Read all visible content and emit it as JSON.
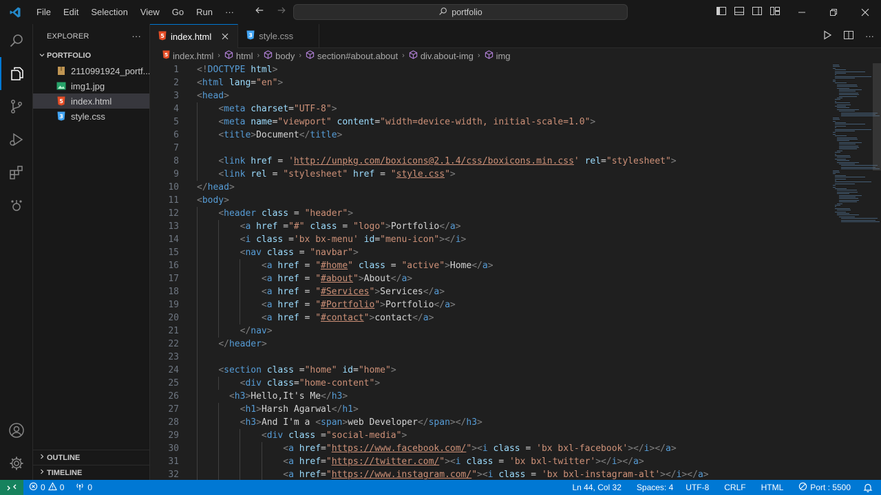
{
  "titlebar": {
    "menus": [
      "File",
      "Edit",
      "Selection",
      "View",
      "Go",
      "Run",
      "···"
    ],
    "search": "portfolio"
  },
  "explorer": {
    "title": "EXPLORER",
    "more": "···",
    "folder": "PORTFOLIO",
    "files": [
      {
        "name": "2110991924_portf...",
        "icon": "zip-icon",
        "color": "#c09553"
      },
      {
        "name": "img1.jpg",
        "icon": "image-icon",
        "color": "#26a269"
      },
      {
        "name": "index.html",
        "icon": "html-icon",
        "color": "#e44d26"
      },
      {
        "name": "style.css",
        "icon": "css-icon",
        "color": "#42a5f5"
      }
    ],
    "outline": "OUTLINE",
    "timeline": "TIMELINE"
  },
  "tabs": [
    {
      "label": "index.html",
      "active": true
    },
    {
      "label": "style.css",
      "active": false
    }
  ],
  "breadcrumb": [
    "index.html",
    "html",
    "body",
    "section#about.about",
    "div.about-img",
    "img"
  ],
  "code_lines": [
    {
      "n": "1",
      "i": 0,
      "t": [
        [
          "br",
          "<!"
        ],
        [
          "tag",
          "DOCTYPE"
        ],
        [
          "txt",
          " "
        ],
        [
          "attr",
          "html"
        ],
        [
          "br",
          ">"
        ]
      ]
    },
    {
      "n": "2",
      "i": 0,
      "t": [
        [
          "br",
          "<"
        ],
        [
          "tag",
          "html"
        ],
        [
          "txt",
          " "
        ],
        [
          "attr",
          "lang"
        ],
        [
          "txt",
          "="
        ],
        [
          "str",
          "\"en\""
        ],
        [
          "br",
          ">"
        ]
      ]
    },
    {
      "n": "3",
      "i": 0,
      "t": [
        [
          "br",
          "<"
        ],
        [
          "tag",
          "head"
        ],
        [
          "br",
          ">"
        ]
      ]
    },
    {
      "n": "4",
      "i": 1,
      "t": [
        [
          "br",
          "<"
        ],
        [
          "tag",
          "meta"
        ],
        [
          "txt",
          " "
        ],
        [
          "attr",
          "charset"
        ],
        [
          "txt",
          "="
        ],
        [
          "str",
          "\"UTF-8\""
        ],
        [
          "br",
          ">"
        ]
      ]
    },
    {
      "n": "5",
      "i": 1,
      "t": [
        [
          "br",
          "<"
        ],
        [
          "tag",
          "meta"
        ],
        [
          "txt",
          " "
        ],
        [
          "attr",
          "name"
        ],
        [
          "txt",
          "="
        ],
        [
          "str",
          "\"viewport\""
        ],
        [
          "txt",
          " "
        ],
        [
          "attr",
          "content"
        ],
        [
          "txt",
          "="
        ],
        [
          "str",
          "\"width=device-width, initial-scale=1.0\""
        ],
        [
          "br",
          ">"
        ]
      ]
    },
    {
      "n": "6",
      "i": 1,
      "t": [
        [
          "br",
          "<"
        ],
        [
          "tag",
          "title"
        ],
        [
          "br",
          ">"
        ],
        [
          "txt",
          "Document"
        ],
        [
          "br",
          "</"
        ],
        [
          "tag",
          "title"
        ],
        [
          "br",
          ">"
        ]
      ]
    },
    {
      "n": "7",
      "i": 1,
      "t": []
    },
    {
      "n": "8",
      "i": 1,
      "t": [
        [
          "br",
          "<"
        ],
        [
          "tag",
          "link"
        ],
        [
          "txt",
          " "
        ],
        [
          "attr",
          "href"
        ],
        [
          "txt",
          " = "
        ],
        [
          "str",
          "'"
        ],
        [
          "link",
          "http://unpkg.com/boxicons@2.1.4/css/boxicons.min.css"
        ],
        [
          "str",
          "'"
        ],
        [
          "txt",
          " "
        ],
        [
          "attr",
          "rel"
        ],
        [
          "txt",
          "="
        ],
        [
          "str",
          "\"stylesheet\""
        ],
        [
          "br",
          ">"
        ]
      ]
    },
    {
      "n": "9",
      "i": 1,
      "t": [
        [
          "br",
          "<"
        ],
        [
          "tag",
          "link"
        ],
        [
          "txt",
          " "
        ],
        [
          "attr",
          "rel"
        ],
        [
          "txt",
          " = "
        ],
        [
          "str",
          "\"stylesheet\""
        ],
        [
          "txt",
          " "
        ],
        [
          "attr",
          "href"
        ],
        [
          "txt",
          " = "
        ],
        [
          "str",
          "\""
        ],
        [
          "link",
          "style.css"
        ],
        [
          "str",
          "\""
        ],
        [
          "br",
          ">"
        ]
      ]
    },
    {
      "n": "10",
      "i": 0,
      "t": [
        [
          "br",
          "</"
        ],
        [
          "tag",
          "head"
        ],
        [
          "br",
          ">"
        ]
      ]
    },
    {
      "n": "11",
      "i": 0,
      "t": [
        [
          "br",
          "<"
        ],
        [
          "tag",
          "body"
        ],
        [
          "br",
          ">"
        ]
      ]
    },
    {
      "n": "12",
      "i": 1,
      "t": [
        [
          "br",
          "<"
        ],
        [
          "tag",
          "header"
        ],
        [
          "txt",
          " "
        ],
        [
          "attr",
          "class"
        ],
        [
          "txt",
          " = "
        ],
        [
          "str",
          "\"header\""
        ],
        [
          "br",
          ">"
        ]
      ]
    },
    {
      "n": "13",
      "i": 2,
      "t": [
        [
          "br",
          "<"
        ],
        [
          "tag",
          "a"
        ],
        [
          "txt",
          " "
        ],
        [
          "attr",
          "href"
        ],
        [
          "txt",
          " ="
        ],
        [
          "str",
          "\"#\""
        ],
        [
          "txt",
          " "
        ],
        [
          "attr",
          "class"
        ],
        [
          "txt",
          " = "
        ],
        [
          "str",
          "\"logo\""
        ],
        [
          "br",
          ">"
        ],
        [
          "txt",
          "Portfolio"
        ],
        [
          "br",
          "</"
        ],
        [
          "tag",
          "a"
        ],
        [
          "br",
          ">"
        ]
      ]
    },
    {
      "n": "14",
      "i": 2,
      "t": [
        [
          "br",
          "<"
        ],
        [
          "tag",
          "i"
        ],
        [
          "txt",
          " "
        ],
        [
          "attr",
          "class"
        ],
        [
          "txt",
          " ="
        ],
        [
          "str",
          "'bx bx-menu'"
        ],
        [
          "txt",
          " "
        ],
        [
          "attr",
          "id"
        ],
        [
          "txt",
          "="
        ],
        [
          "str",
          "\"menu-icon\""
        ],
        [
          "br",
          "></"
        ],
        [
          "tag",
          "i"
        ],
        [
          "br",
          ">"
        ]
      ]
    },
    {
      "n": "15",
      "i": 2,
      "t": [
        [
          "br",
          "<"
        ],
        [
          "tag",
          "nav"
        ],
        [
          "txt",
          " "
        ],
        [
          "attr",
          "class"
        ],
        [
          "txt",
          " = "
        ],
        [
          "str",
          "\"navbar\""
        ],
        [
          "br",
          ">"
        ]
      ]
    },
    {
      "n": "16",
      "i": 3,
      "t": [
        [
          "br",
          "<"
        ],
        [
          "tag",
          "a"
        ],
        [
          "txt",
          " "
        ],
        [
          "attr",
          "href"
        ],
        [
          "txt",
          " = "
        ],
        [
          "str",
          "\""
        ],
        [
          "link",
          "#home"
        ],
        [
          "str",
          "\""
        ],
        [
          "txt",
          " "
        ],
        [
          "attr",
          "class"
        ],
        [
          "txt",
          " = "
        ],
        [
          "str",
          "\"active\""
        ],
        [
          "br",
          ">"
        ],
        [
          "txt",
          "Home"
        ],
        [
          "br",
          "</"
        ],
        [
          "tag",
          "a"
        ],
        [
          "br",
          ">"
        ]
      ]
    },
    {
      "n": "17",
      "i": 3,
      "t": [
        [
          "br",
          "<"
        ],
        [
          "tag",
          "a"
        ],
        [
          "txt",
          " "
        ],
        [
          "attr",
          "href"
        ],
        [
          "txt",
          " = "
        ],
        [
          "str",
          "\""
        ],
        [
          "link",
          "#about"
        ],
        [
          "str",
          "\""
        ],
        [
          "br",
          ">"
        ],
        [
          "txt",
          "About"
        ],
        [
          "br",
          "</"
        ],
        [
          "tag",
          "a"
        ],
        [
          "br",
          ">"
        ]
      ]
    },
    {
      "n": "18",
      "i": 3,
      "t": [
        [
          "br",
          "<"
        ],
        [
          "tag",
          "a"
        ],
        [
          "txt",
          " "
        ],
        [
          "attr",
          "href"
        ],
        [
          "txt",
          " = "
        ],
        [
          "str",
          "\""
        ],
        [
          "link",
          "#Services"
        ],
        [
          "str",
          "\""
        ],
        [
          "br",
          ">"
        ],
        [
          "txt",
          "Services"
        ],
        [
          "br",
          "</"
        ],
        [
          "tag",
          "a"
        ],
        [
          "br",
          ">"
        ]
      ]
    },
    {
      "n": "19",
      "i": 3,
      "t": [
        [
          "br",
          "<"
        ],
        [
          "tag",
          "a"
        ],
        [
          "txt",
          " "
        ],
        [
          "attr",
          "href"
        ],
        [
          "txt",
          " = "
        ],
        [
          "str",
          "\""
        ],
        [
          "link",
          "#Portfolio"
        ],
        [
          "str",
          "\""
        ],
        [
          "br",
          ">"
        ],
        [
          "txt",
          "Portfolio"
        ],
        [
          "br",
          "</"
        ],
        [
          "tag",
          "a"
        ],
        [
          "br",
          ">"
        ]
      ]
    },
    {
      "n": "20",
      "i": 3,
      "t": [
        [
          "br",
          "<"
        ],
        [
          "tag",
          "a"
        ],
        [
          "txt",
          " "
        ],
        [
          "attr",
          "href"
        ],
        [
          "txt",
          " = "
        ],
        [
          "str",
          "\""
        ],
        [
          "link",
          "#contact"
        ],
        [
          "str",
          "\""
        ],
        [
          "br",
          ">"
        ],
        [
          "txt",
          "contact"
        ],
        [
          "br",
          "</"
        ],
        [
          "tag",
          "a"
        ],
        [
          "br",
          ">"
        ]
      ]
    },
    {
      "n": "21",
      "i": 2,
      "t": [
        [
          "br",
          "</"
        ],
        [
          "tag",
          "nav"
        ],
        [
          "br",
          ">"
        ]
      ]
    },
    {
      "n": "22",
      "i": 1,
      "t": [
        [
          "br",
          "</"
        ],
        [
          "tag",
          "header"
        ],
        [
          "br",
          ">"
        ]
      ]
    },
    {
      "n": "23",
      "i": 1,
      "t": []
    },
    {
      "n": "24",
      "i": 1,
      "t": [
        [
          "br",
          "<"
        ],
        [
          "tag",
          "section"
        ],
        [
          "txt",
          " "
        ],
        [
          "attr",
          "class"
        ],
        [
          "txt",
          " ="
        ],
        [
          "str",
          "\"home\""
        ],
        [
          "txt",
          " "
        ],
        [
          "attr",
          "id"
        ],
        [
          "txt",
          "="
        ],
        [
          "str",
          "\"home\""
        ],
        [
          "br",
          ">"
        ]
      ]
    },
    {
      "n": "25",
      "i": 2,
      "t": [
        [
          "br",
          "<"
        ],
        [
          "tag",
          "div"
        ],
        [
          "txt",
          " "
        ],
        [
          "attr",
          "class"
        ],
        [
          "txt",
          "="
        ],
        [
          "str",
          "\"home-content\""
        ],
        [
          "br",
          ">"
        ]
      ]
    },
    {
      "n": "26",
      "i": 1,
      "pre": "  ",
      "t": [
        [
          "br",
          "<"
        ],
        [
          "tag",
          "h3"
        ],
        [
          "br",
          ">"
        ],
        [
          "txt",
          "Hello,It's Me"
        ],
        [
          "br",
          "</"
        ],
        [
          "tag",
          "h3"
        ],
        [
          "br",
          ">"
        ]
      ]
    },
    {
      "n": "27",
      "i": 2,
      "t": [
        [
          "br",
          "<"
        ],
        [
          "tag",
          "h1"
        ],
        [
          "br",
          ">"
        ],
        [
          "txt",
          "Harsh Agarwal"
        ],
        [
          "br",
          "</"
        ],
        [
          "tag",
          "h1"
        ],
        [
          "br",
          ">"
        ]
      ]
    },
    {
      "n": "28",
      "i": 2,
      "t": [
        [
          "br",
          "<"
        ],
        [
          "tag",
          "h3"
        ],
        [
          "br",
          ">"
        ],
        [
          "txt",
          "And I'm a "
        ],
        [
          "br",
          "<"
        ],
        [
          "tag",
          "span"
        ],
        [
          "br",
          ">"
        ],
        [
          "txt",
          "web Developer"
        ],
        [
          "br",
          "</"
        ],
        [
          "tag",
          "span"
        ],
        [
          "br",
          "></"
        ],
        [
          "tag",
          "h3"
        ],
        [
          "br",
          ">"
        ]
      ]
    },
    {
      "n": "29",
      "i": 3,
      "t": [
        [
          "br",
          "<"
        ],
        [
          "tag",
          "div"
        ],
        [
          "txt",
          " "
        ],
        [
          "attr",
          "class"
        ],
        [
          "txt",
          " ="
        ],
        [
          "str",
          "\"social-media\""
        ],
        [
          "br",
          ">"
        ]
      ]
    },
    {
      "n": "30",
      "i": 4,
      "t": [
        [
          "br",
          "<"
        ],
        [
          "tag",
          "a"
        ],
        [
          "txt",
          " "
        ],
        [
          "attr",
          "href"
        ],
        [
          "txt",
          "="
        ],
        [
          "str",
          "\""
        ],
        [
          "link",
          "https://www.facebook.com/"
        ],
        [
          "str",
          "\""
        ],
        [
          "br",
          "><"
        ],
        [
          "tag",
          "i"
        ],
        [
          "txt",
          " "
        ],
        [
          "attr",
          "class"
        ],
        [
          "txt",
          " = "
        ],
        [
          "str",
          "'bx bxl-facebook'"
        ],
        [
          "br",
          "></"
        ],
        [
          "tag",
          "i"
        ],
        [
          "br",
          "></"
        ],
        [
          "tag",
          "a"
        ],
        [
          "br",
          ">"
        ]
      ]
    },
    {
      "n": "31",
      "i": 4,
      "t": [
        [
          "br",
          "<"
        ],
        [
          "tag",
          "a"
        ],
        [
          "txt",
          " "
        ],
        [
          "attr",
          "href"
        ],
        [
          "txt",
          "="
        ],
        [
          "str",
          "\""
        ],
        [
          "link",
          "https://twitter.com/"
        ],
        [
          "str",
          "\""
        ],
        [
          "br",
          "><"
        ],
        [
          "tag",
          "i"
        ],
        [
          "txt",
          " "
        ],
        [
          "attr",
          "class"
        ],
        [
          "txt",
          " = "
        ],
        [
          "str",
          "'bx bxl-twitter'"
        ],
        [
          "br",
          "></"
        ],
        [
          "tag",
          "i"
        ],
        [
          "br",
          "></"
        ],
        [
          "tag",
          "a"
        ],
        [
          "br",
          ">"
        ]
      ]
    },
    {
      "n": "32",
      "i": 4,
      "t": [
        [
          "br",
          "<"
        ],
        [
          "tag",
          "a"
        ],
        [
          "txt",
          " "
        ],
        [
          "attr",
          "href"
        ],
        [
          "txt",
          "="
        ],
        [
          "str",
          "\""
        ],
        [
          "link",
          "https://www.instagram.com/"
        ],
        [
          "str",
          "\""
        ],
        [
          "br",
          "><"
        ],
        [
          "tag",
          "i"
        ],
        [
          "txt",
          " "
        ],
        [
          "attr",
          "class"
        ],
        [
          "txt",
          " = "
        ],
        [
          "str",
          "'bx bxl-instagram-alt'"
        ],
        [
          "br",
          "></"
        ],
        [
          "tag",
          "i"
        ],
        [
          "br",
          "></"
        ],
        [
          "tag",
          "a"
        ],
        [
          "br",
          ">"
        ]
      ]
    }
  ],
  "status": {
    "errors": "0",
    "warnings": "0",
    "ports": "0",
    "position": "Ln 44, Col 32",
    "spaces": "Spaces: 4",
    "encoding": "UTF-8",
    "eol": "CRLF",
    "language": "HTML",
    "port": "Port : 5500"
  },
  "colors": {
    "accent": "#0078d4",
    "remote": "#16825d"
  }
}
